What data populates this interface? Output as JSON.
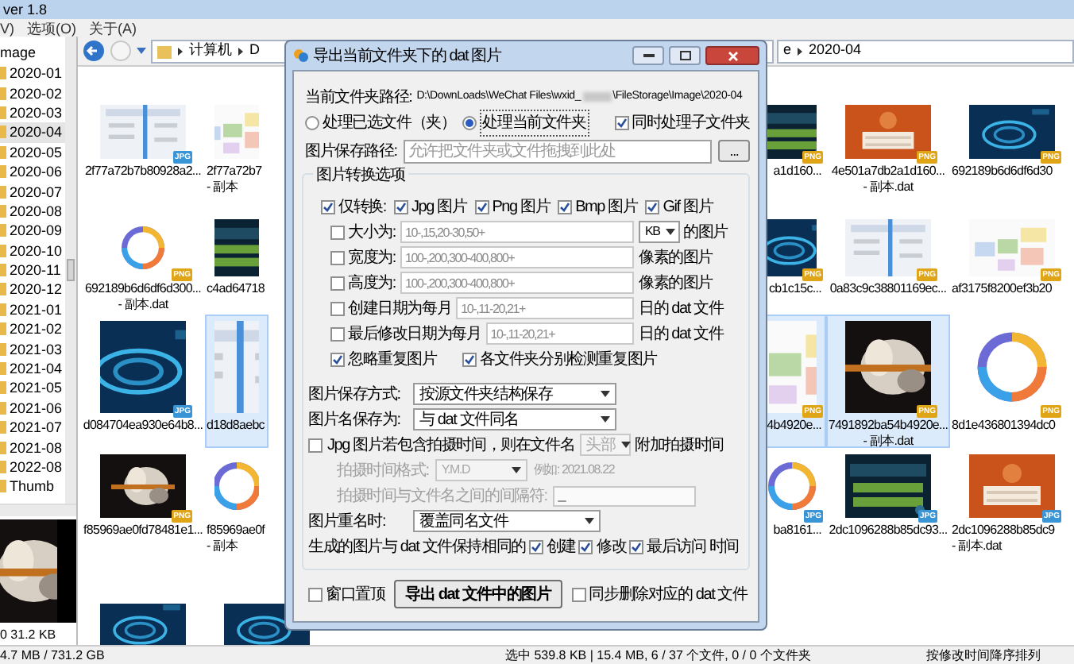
{
  "explorer": {
    "title": "ver 1.8",
    "menu": [
      "V)",
      "选项(O)",
      "关于(A)"
    ],
    "address": {
      "crumbs": [
        "计算机",
        "D"
      ],
      "tail": [
        "e",
        "2020-04"
      ]
    },
    "tree": {
      "header": "mage",
      "items": [
        {
          "label": "2020-01",
          "selected": false
        },
        {
          "label": "2020-02",
          "selected": false
        },
        {
          "label": "2020-03",
          "selected": false
        },
        {
          "label": "2020-04",
          "selected": true
        },
        {
          "label": "2020-05",
          "selected": false
        },
        {
          "label": "2020-06",
          "selected": false
        },
        {
          "label": "2020-07",
          "selected": false
        },
        {
          "label": "2020-08",
          "selected": false
        },
        {
          "label": "2020-09",
          "selected": false
        },
        {
          "label": "2020-10",
          "selected": false
        },
        {
          "label": "2020-11",
          "selected": false
        },
        {
          "label": "2020-12",
          "selected": false
        },
        {
          "label": "2021-01",
          "selected": false
        },
        {
          "label": "2021-02",
          "selected": false
        },
        {
          "label": "2021-03",
          "selected": false
        },
        {
          "label": "2021-04",
          "selected": false
        },
        {
          "label": "2021-05",
          "selected": false
        },
        {
          "label": "2021-06",
          "selected": false
        },
        {
          "label": "2021-07",
          "selected": false
        },
        {
          "label": "2021-08",
          "selected": false
        },
        {
          "label": "2022-08",
          "selected": false
        },
        {
          "label": "Thumb",
          "selected": false
        }
      ]
    },
    "preview_info": "0  31.2 KB",
    "file_rows": [
      {
        "left": [
          {
            "name": [
              "2f77a72b7b80928a2..."
            ],
            "badge": {
              "text": "JPG",
              "color": "#3a95d6"
            },
            "selected": false
          },
          {
            "name": [
              "2f77a72b7",
              "- 副本"
            ],
            "selected": false
          }
        ],
        "right": [
          {
            "name": [
              "a1d160..."
            ],
            "badge": {
              "text": "PNG",
              "color": "#e0a516"
            },
            "selected": false
          },
          {
            "name": [
              "4e501a7db2a1d160...",
              "- 副本.dat"
            ],
            "badge": {
              "text": "PNG",
              "color": "#e0a516"
            },
            "selected": false
          },
          {
            "name": [
              "692189b6d6df6d30"
            ],
            "badge": {
              "text": "PNG",
              "color": "#e0a516"
            },
            "selected": false
          }
        ]
      },
      {
        "left": [
          {
            "name": [
              "692189b6d6df6d300...",
              "- 副本.dat"
            ],
            "badge": {
              "text": "PNG",
              "color": "#e0a516"
            },
            "selected": false
          },
          {
            "name": [
              "c4ad64718"
            ],
            "selected": false
          }
        ],
        "right": [
          {
            "name": [
              "cb1c15c..."
            ],
            "badge": {
              "text": "PNG",
              "color": "#e0a516"
            },
            "selected": false
          },
          {
            "name": [
              "0a83c9c38801169ec..."
            ],
            "badge": {
              "text": "PNG",
              "color": "#e0a516"
            },
            "selected": false
          },
          {
            "name": [
              "af3175f8200ef3b20"
            ],
            "badge": {
              "text": "PNG",
              "color": "#e0a516"
            },
            "selected": false
          }
        ]
      },
      {
        "left": [
          {
            "name": [
              "d084704ea930e64b8..."
            ],
            "badge": {
              "text": "JPG",
              "color": "#3a95d6"
            },
            "selected": false
          },
          {
            "name": [
              "d18d8aebc"
            ],
            "selected": true
          }
        ],
        "right": [
          {
            "name": [
              "4b4920e..."
            ],
            "badge": {
              "text": "PNG",
              "color": "#e0a516"
            },
            "selected": true
          },
          {
            "name": [
              "7491892ba54b4920e...",
              "- 副本.dat"
            ],
            "badge": {
              "text": "PNG",
              "color": "#e0a516"
            },
            "selected": true
          },
          {
            "name": [
              "8d1e436801394dc0"
            ],
            "badge": {
              "text": "PNG",
              "color": "#e0a516"
            },
            "selected": false
          }
        ]
      },
      {
        "left": [
          {
            "name": [
              "f85969ae0fd78481e1..."
            ],
            "badge": {
              "text": "PNG",
              "color": "#e0a516"
            },
            "selected": false
          },
          {
            "name": [
              "f85969ae0f",
              "- 副本"
            ],
            "selected": false
          }
        ],
        "right": [
          {
            "name": [
              "ba8161..."
            ],
            "badge": {
              "text": "JPG",
              "color": "#3a95d6"
            },
            "selected": false
          },
          {
            "name": [
              "2dc1096288b85dc93..."
            ],
            "badge": {
              "text": "JPG",
              "color": "#3a95d6"
            },
            "selected": false
          },
          {
            "name": [
              "2dc1096288b85dc9",
              "- 副本.dat"
            ],
            "badge": {
              "text": "JPG",
              "color": "#3a95d6"
            },
            "selected": false
          }
        ]
      }
    ],
    "status": {
      "disk": "4.7 MB / 731.2 GB",
      "selection": "选中 539.8 KB | 15.4 MB, 6 / 37 个文件, 0 / 0 个文件夹",
      "sort": "按修改时间降序排列"
    }
  },
  "dialog": {
    "title": "导出当前文件夹下的 dat 图片",
    "folder_path": {
      "label": "当前文件夹路径:",
      "before": "D:\\DownLoads\\WeChat Files\\wxid_",
      "after": "\\FileStorage\\Image\\2020-04"
    },
    "scope": [
      {
        "label": "处理已选文件（夹）",
        "selected": false
      },
      {
        "label": "处理当前文件夹",
        "selected": true
      }
    ],
    "include_subfolders": {
      "label": "同时处理子文件夹",
      "checked": true
    },
    "save_path": {
      "label": "图片保存路径:",
      "placeholder": "允许把文件夹或文件拖拽到此处",
      "button": "..."
    },
    "group_title": "图片转换选项",
    "only_convert": {
      "label": "仅转换:",
      "checked": true,
      "types": [
        {
          "label": "Jpg 图片",
          "checked": true
        },
        {
          "label": "Png 图片",
          "checked": true
        },
        {
          "label": "Bmp 图片",
          "checked": true
        },
        {
          "label": "Gif 图片",
          "checked": true
        }
      ]
    },
    "filters": [
      {
        "label": "大小为:",
        "checked": false,
        "placeholder": "10-,15,20-30,50+",
        "unit": "KB",
        "suffix": "的图片"
      },
      {
        "label": "宽度为:",
        "checked": false,
        "placeholder": "100-,200,300-400,800+",
        "suffix": "像素的图片"
      },
      {
        "label": "高度为:",
        "checked": false,
        "placeholder": "100-,200,300-400,800+",
        "suffix": "像素的图片"
      },
      {
        "label": "创建日期为每月",
        "checked": false,
        "placeholder": "10-,11-20,21+",
        "suffix": "日的 dat 文件"
      },
      {
        "label": "最后修改日期为每月",
        "checked": false,
        "placeholder": "10-,11-20,21+",
        "suffix": "日的 dat 文件"
      }
    ],
    "duplicates": [
      {
        "label": "忽略重复图片",
        "checked": true
      },
      {
        "label": "各文件夹分别检测重复图片",
        "checked": true
      }
    ],
    "selects": [
      {
        "label": "图片保存方式:",
        "value": "按源文件夹结构保存"
      },
      {
        "label": "图片名保存为:",
        "value": "与 dat 文件同名"
      }
    ],
    "shot_time": {
      "label_before": "Jpg 图片若包含拍摄时间，则在文件名",
      "checked": false,
      "position": "头部",
      "label_after": "附加拍摄时间"
    },
    "shot_format": {
      "label": "拍摄时间格式:",
      "value": "Y.M.D",
      "example": "例如: 2021.08.22",
      "disabled": true
    },
    "separator": {
      "label": "拍摄时间与文件名之间的间隔符:",
      "value": "_",
      "disabled": true
    },
    "rename": {
      "label": "图片重名时:",
      "value": "覆盖同名文件"
    },
    "keep_time": {
      "before": "生成的图片与 dat 文件保持相同的",
      "options": [
        {
          "label": "创建",
          "checked": true
        },
        {
          "label": "修改",
          "checked": true
        },
        {
          "label": "最后访问",
          "checked": true
        }
      ],
      "after": "时间"
    },
    "topmost": {
      "label": "窗口置顶",
      "checked": false
    },
    "export_button": "导出 dat 文件中的图片",
    "delete_dat": {
      "label": "同步删除对应的 dat 文件",
      "checked": false
    }
  }
}
